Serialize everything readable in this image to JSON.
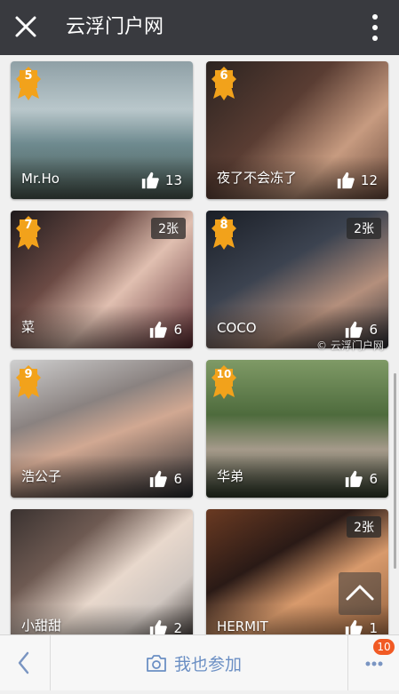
{
  "header": {
    "title": "云浮门户网"
  },
  "colors": {
    "topbar": "#393a3f",
    "badge": "#f2a21b",
    "notification": "#f15a24",
    "join_text": "#6b8fc4"
  },
  "cards": [
    {
      "rank": "5",
      "name": "Mr.Ho",
      "likes": "13",
      "photo_count": ""
    },
    {
      "rank": "6",
      "name": "夜了不会冻了",
      "likes": "12",
      "photo_count": ""
    },
    {
      "rank": "7",
      "name": "菜",
      "likes": "6",
      "photo_count": "2张"
    },
    {
      "rank": "8",
      "name": "COCO",
      "likes": "6",
      "photo_count": "2张"
    },
    {
      "rank": "9",
      "name": "浩公子",
      "likes": "6",
      "photo_count": ""
    },
    {
      "rank": "10",
      "name": "华弟",
      "likes": "6",
      "photo_count": ""
    },
    {
      "rank": "",
      "name": "小甜甜",
      "likes": "2",
      "photo_count": ""
    },
    {
      "rank": "",
      "name": "HERMIT",
      "likes": "1",
      "photo_count": "2张"
    }
  ],
  "watermark": "© 云浮门户网",
  "bottom": {
    "join_label": "我也参加",
    "notification_count": "10"
  },
  "icons": [
    "close-icon",
    "more-vertical-icon",
    "thumbs-up-icon",
    "camera-icon",
    "back-chevron-icon",
    "more-dots-icon",
    "scroll-to-top-icon"
  ]
}
